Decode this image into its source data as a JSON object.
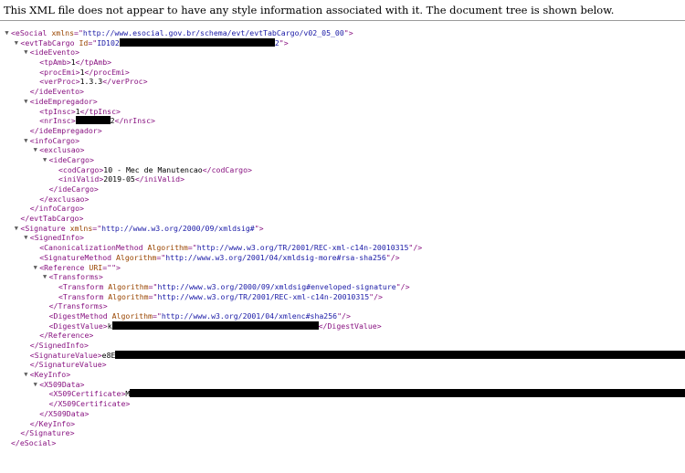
{
  "notice": "This XML file does not appear to have any style information associated with it. The document tree is shown below.",
  "toggle_expanded": "▼",
  "redaction_label": "redacted",
  "lines": [
    {
      "d": 0,
      "t": 1,
      "p": [
        [
          "tg",
          "<eSocial "
        ],
        [
          "an",
          "xmlns"
        ],
        [
          "tg",
          "=\""
        ],
        [
          "av",
          "http://www.esocial.gov.br/schema/evt/evtTabCargo/v02_05_00"
        ],
        [
          "tg",
          "\">"
        ]
      ]
    },
    {
      "d": 1,
      "t": 1,
      "p": [
        [
          "tg",
          "<evtTabCargo "
        ],
        [
          "an",
          "Id"
        ],
        [
          "tg",
          "=\""
        ],
        [
          "av",
          "ID102"
        ],
        [
          "r",
          170
        ],
        [
          "av",
          "2"
        ],
        [
          "tg",
          "\">"
        ]
      ]
    },
    {
      "d": 2,
      "t": 1,
      "p": [
        [
          "tg",
          "<ideEvento>"
        ]
      ]
    },
    {
      "d": 3,
      "t": 0,
      "p": [
        [
          "tg",
          "<tpAmb>"
        ],
        [
          "tx",
          "1"
        ],
        [
          "tg",
          "</tpAmb>"
        ]
      ]
    },
    {
      "d": 3,
      "t": 0,
      "p": [
        [
          "tg",
          "<procEmi>"
        ],
        [
          "tx",
          "1"
        ],
        [
          "tg",
          "</procEmi>"
        ]
      ]
    },
    {
      "d": 3,
      "t": 0,
      "p": [
        [
          "tg",
          "<verProc>"
        ],
        [
          "tx",
          "1.3.3"
        ],
        [
          "tg",
          "</verProc>"
        ]
      ]
    },
    {
      "d": 2,
      "t": 0,
      "p": [
        [
          "tg",
          "</ideEvento>"
        ]
      ]
    },
    {
      "d": 2,
      "t": 1,
      "p": [
        [
          "tg",
          "<ideEmpregador>"
        ]
      ]
    },
    {
      "d": 3,
      "t": 0,
      "p": [
        [
          "tg",
          "<tpInsc>"
        ],
        [
          "tx",
          "1"
        ],
        [
          "tg",
          "</tpInsc>"
        ]
      ]
    },
    {
      "d": 3,
      "t": 0,
      "p": [
        [
          "tg",
          "<nrInsc>"
        ],
        [
          "r",
          38
        ],
        [
          "tx",
          "2"
        ],
        [
          "tg",
          "</nrInsc>"
        ]
      ]
    },
    {
      "d": 2,
      "t": 0,
      "p": [
        [
          "tg",
          "</ideEmpregador>"
        ]
      ]
    },
    {
      "d": 2,
      "t": 1,
      "p": [
        [
          "tg",
          "<infoCargo>"
        ]
      ]
    },
    {
      "d": 3,
      "t": 1,
      "p": [
        [
          "tg",
          "<exclusao>"
        ]
      ]
    },
    {
      "d": 4,
      "t": 1,
      "p": [
        [
          "tg",
          "<ideCargo>"
        ]
      ]
    },
    {
      "d": 5,
      "t": 0,
      "p": [
        [
          "tg",
          "<codCargo>"
        ],
        [
          "tx",
          "10 - Mec de Manutencao"
        ],
        [
          "tg",
          "</codCargo>"
        ]
      ]
    },
    {
      "d": 5,
      "t": 0,
      "p": [
        [
          "tg",
          "<iniValid>"
        ],
        [
          "tx",
          "2019-05"
        ],
        [
          "tg",
          "</iniValid>"
        ]
      ]
    },
    {
      "d": 4,
      "t": 0,
      "p": [
        [
          "tg",
          "</ideCargo>"
        ]
      ]
    },
    {
      "d": 3,
      "t": 0,
      "p": [
        [
          "tg",
          "</exclusao>"
        ]
      ]
    },
    {
      "d": 2,
      "t": 0,
      "p": [
        [
          "tg",
          "</infoCargo>"
        ]
      ]
    },
    {
      "d": 1,
      "t": 0,
      "p": [
        [
          "tg",
          "</evtTabCargo>"
        ]
      ]
    },
    {
      "d": 1,
      "t": 1,
      "p": [
        [
          "tg",
          "<Signature "
        ],
        [
          "an",
          "xmlns"
        ],
        [
          "tg",
          "=\""
        ],
        [
          "av",
          "http://www.w3.org/2000/09/xmldsig#"
        ],
        [
          "tg",
          "\">"
        ]
      ]
    },
    {
      "d": 2,
      "t": 1,
      "p": [
        [
          "tg",
          "<SignedInfo>"
        ]
      ]
    },
    {
      "d": 3,
      "t": 0,
      "p": [
        [
          "tg",
          "<CanonicalizationMethod "
        ],
        [
          "an",
          "Algorithm"
        ],
        [
          "tg",
          "=\""
        ],
        [
          "av",
          "http://www.w3.org/TR/2001/REC-xml-c14n-20010315"
        ],
        [
          "tg",
          "\"/>"
        ]
      ]
    },
    {
      "d": 3,
      "t": 0,
      "p": [
        [
          "tg",
          "<SignatureMethod "
        ],
        [
          "an",
          "Algorithm"
        ],
        [
          "tg",
          "=\""
        ],
        [
          "av",
          "http://www.w3.org/2001/04/xmldsig-more#rsa-sha256"
        ],
        [
          "tg",
          "\"/>"
        ]
      ]
    },
    {
      "d": 3,
      "t": 1,
      "p": [
        [
          "tg",
          "<Reference "
        ],
        [
          "an",
          "URI"
        ],
        [
          "tg",
          "=\""
        ],
        [
          "av",
          ""
        ],
        [
          "tg",
          "\">"
        ]
      ]
    },
    {
      "d": 4,
      "t": 1,
      "p": [
        [
          "tg",
          "<Transforms>"
        ]
      ]
    },
    {
      "d": 5,
      "t": 0,
      "p": [
        [
          "tg",
          "<Transform "
        ],
        [
          "an",
          "Algorithm"
        ],
        [
          "tg",
          "=\""
        ],
        [
          "av",
          "http://www.w3.org/2000/09/xmldsig#enveloped-signature"
        ],
        [
          "tg",
          "\"/>"
        ]
      ]
    },
    {
      "d": 5,
      "t": 0,
      "p": [
        [
          "tg",
          "<Transform "
        ],
        [
          "an",
          "Algorithm"
        ],
        [
          "tg",
          "=\""
        ],
        [
          "av",
          "http://www.w3.org/TR/2001/REC-xml-c14n-20010315"
        ],
        [
          "tg",
          "\"/>"
        ]
      ]
    },
    {
      "d": 4,
      "t": 0,
      "p": [
        [
          "tg",
          "</Transforms>"
        ]
      ]
    },
    {
      "d": 4,
      "t": 0,
      "p": [
        [
          "tg",
          "<DigestMethod "
        ],
        [
          "an",
          "Algorithm"
        ],
        [
          "tg",
          "=\""
        ],
        [
          "av",
          "http://www.w3.org/2001/04/xmlenc#sha256"
        ],
        [
          "tg",
          "\"/>"
        ]
      ]
    },
    {
      "d": 4,
      "t": 0,
      "p": [
        [
          "tg",
          "<DigestValue>"
        ],
        [
          "tx",
          "k"
        ],
        [
          "r",
          226
        ],
        [
          "tg",
          "</DigestValue>"
        ]
      ]
    },
    {
      "d": 3,
      "t": 0,
      "p": [
        [
          "tg",
          "</Reference>"
        ]
      ]
    },
    {
      "d": 2,
      "t": 0,
      "p": [
        [
          "tg",
          "</SignedInfo>"
        ]
      ]
    },
    {
      "d": 2,
      "t": 0,
      "p": [
        [
          "tg",
          "<SignatureValue>"
        ],
        [
          "tx",
          "e8E"
        ],
        [
          "r",
          640
        ]
      ]
    },
    {
      "d": 2,
      "t": 0,
      "p": [
        [
          "tg",
          "</SignatureValue>"
        ]
      ]
    },
    {
      "d": 2,
      "t": 1,
      "p": [
        [
          "tg",
          "<KeyInfo>"
        ]
      ]
    },
    {
      "d": 3,
      "t": 1,
      "p": [
        [
          "tg",
          "<X509Data>"
        ]
      ]
    },
    {
      "d": 4,
      "t": 0,
      "p": [
        [
          "tg",
          "<X509Certificate>"
        ],
        [
          "tx",
          "M"
        ],
        [
          "r",
          620
        ]
      ]
    },
    {
      "d": 4,
      "t": 0,
      "p": [
        [
          "tg",
          "</X509Certificate>"
        ]
      ]
    },
    {
      "d": 3,
      "t": 0,
      "p": [
        [
          "tg",
          "</X509Data>"
        ]
      ]
    },
    {
      "d": 2,
      "t": 0,
      "p": [
        [
          "tg",
          "</KeyInfo>"
        ]
      ]
    },
    {
      "d": 1,
      "t": 0,
      "p": [
        [
          "tg",
          "</Signature>"
        ]
      ]
    },
    {
      "d": 0,
      "t": 0,
      "p": [
        [
          "tg",
          "</eSocial>"
        ]
      ]
    }
  ]
}
